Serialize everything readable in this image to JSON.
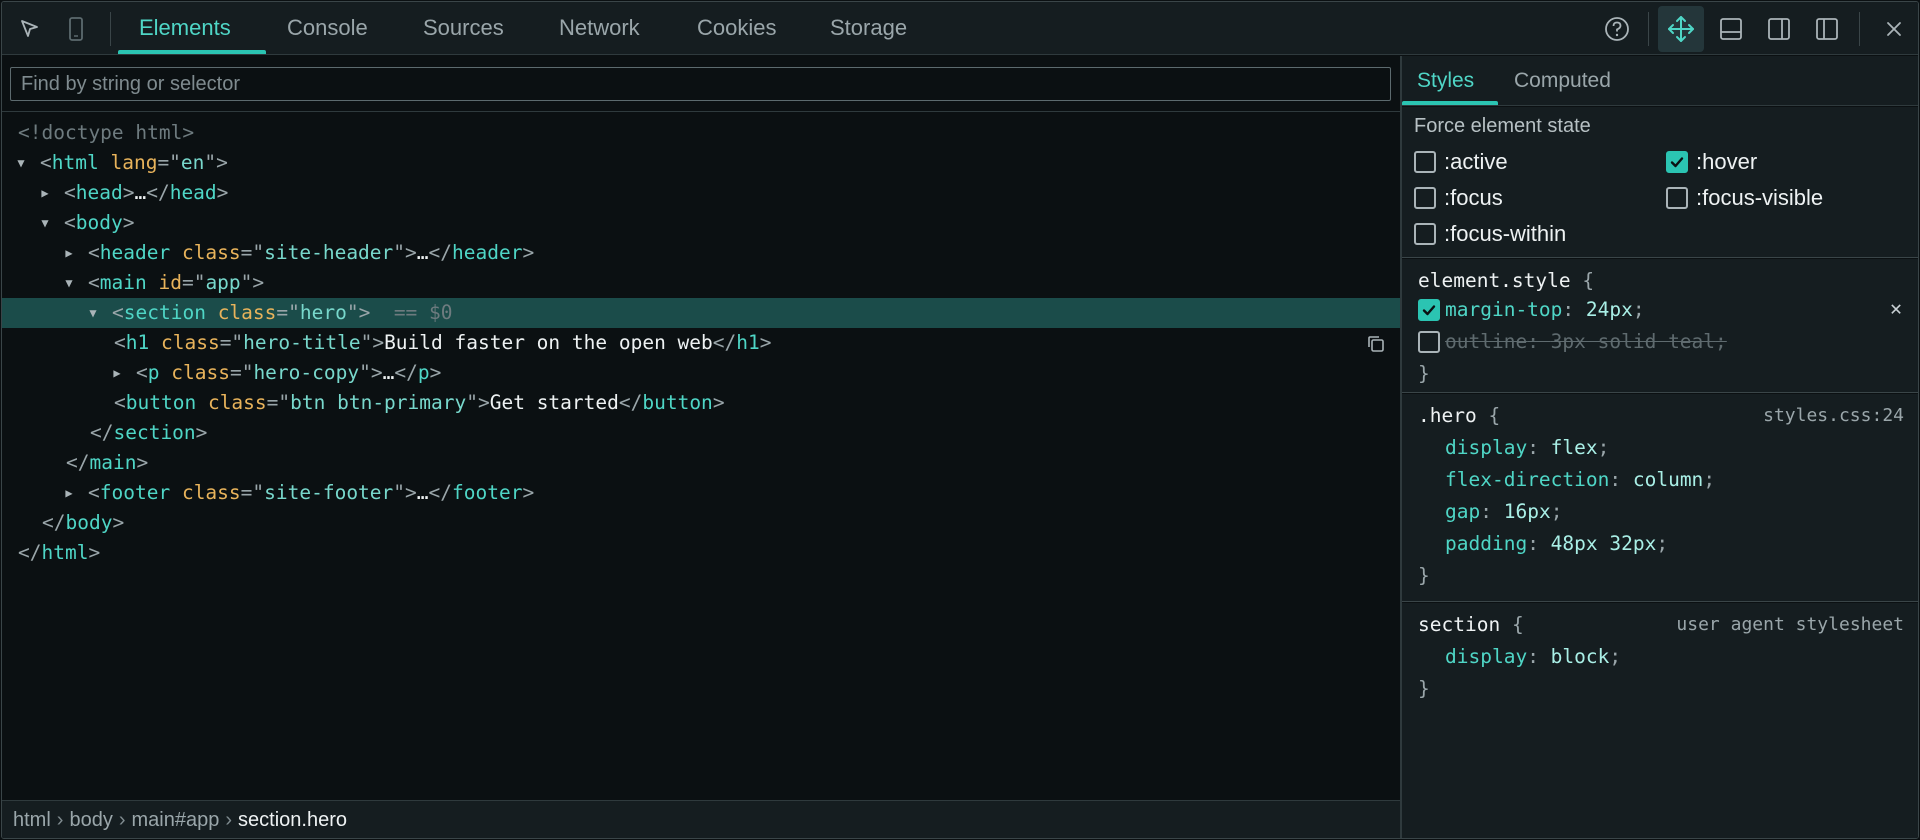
{
  "toolbar": {
    "tabs": [
      "Elements",
      "Console",
      "Sources",
      "Network",
      "Cookies",
      "Storage"
    ],
    "active_tab": "Elements",
    "left_icons": [
      "inspect-cursor-icon",
      "device-toggle-icon"
    ],
    "right_icons": [
      "help-icon",
      "move-icon",
      "dock-bottom-icon",
      "dock-right-icon",
      "dock-left-icon",
      "close-icon"
    ]
  },
  "filter": {
    "placeholder": "Find by string or selector",
    "value": ""
  },
  "dom_tree": {
    "doctype": "<!doctype html>",
    "html_lang": "en",
    "head_collapsed": "…",
    "header_class": "site-header",
    "header_collapsed": "…",
    "main_id": "app",
    "section_class": "hero",
    "section_ref": "== $0",
    "h1_class": "hero-title",
    "h1_text": "Build faster on the open web",
    "p_class": "hero-copy",
    "p_collapsed": "…",
    "button_class": "btn btn-primary",
    "button_text": "Get started",
    "footer_class": "site-footer",
    "footer_collapsed": "…"
  },
  "breadcrumb": [
    "html",
    "body",
    "main#app",
    "section.hero"
  ],
  "styles_panel": {
    "tabs": [
      "Styles",
      "Computed"
    ],
    "active_tab": "Styles",
    "force_state": {
      "title": "Force element state",
      "states": [
        {
          "label": ":active",
          "checked": false
        },
        {
          "label": ":hover",
          "checked": true
        },
        {
          "label": ":focus",
          "checked": false
        },
        {
          "label": ":focus-visible",
          "checked": false
        },
        {
          "label": ":focus-within",
          "checked": false
        }
      ]
    },
    "rules": [
      {
        "selector": "element.style",
        "source": "",
        "declarations": [
          {
            "prop": "margin-top",
            "value": "24px",
            "enabled": true
          },
          {
            "prop": "outline",
            "value": "3px solid teal",
            "enabled": false
          }
        ]
      },
      {
        "selector": ".hero",
        "source": "styles.css:24",
        "declarations": [
          {
            "prop": "display",
            "value": "flex"
          },
          {
            "prop": "flex-direction",
            "value": "column"
          },
          {
            "prop": "gap",
            "value": "16px"
          },
          {
            "prop": "padding",
            "value": "48px 32px"
          }
        ]
      },
      {
        "selector": "section",
        "source": "user agent stylesheet",
        "declarations": [
          {
            "prop": "display",
            "value": "block"
          }
        ]
      }
    ]
  },
  "colors": {
    "accent": "#2bc4b2",
    "selected_row": "#1b4c4a",
    "attr_name": "#e8b35b"
  }
}
